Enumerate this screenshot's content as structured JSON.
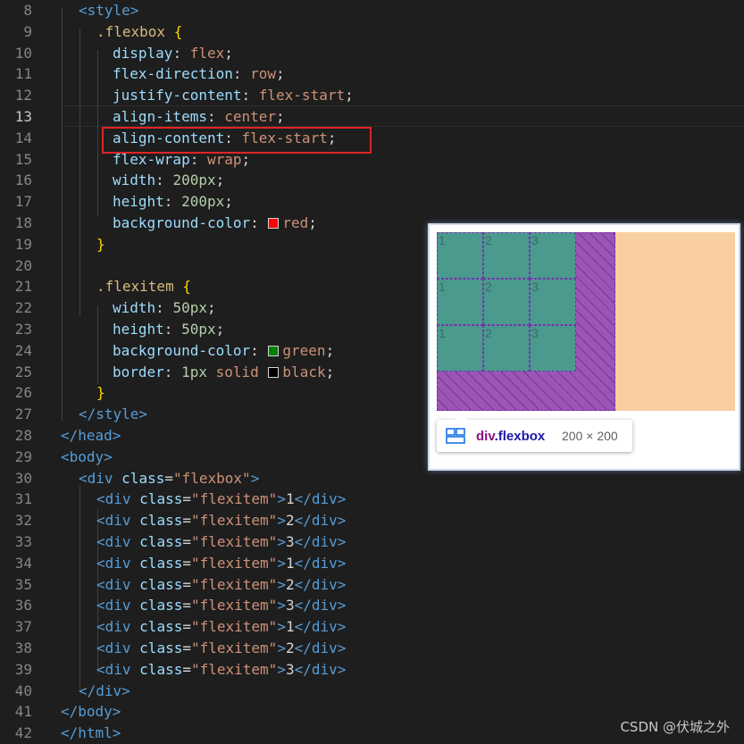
{
  "editor": {
    "lines": [
      {
        "n": "8",
        "indent": 88,
        "segs": [
          [
            "tag",
            "<style>"
          ]
        ]
      },
      {
        "n": "9",
        "indent": 108,
        "segs": [
          [
            "sel",
            ".flexbox "
          ],
          [
            "brace",
            "{"
          ]
        ]
      },
      {
        "n": "10",
        "indent": 126,
        "segs": [
          [
            "prop",
            "display"
          ],
          [
            "txt",
            ": "
          ],
          [
            "val",
            "flex"
          ],
          [
            "txt",
            ";"
          ]
        ]
      },
      {
        "n": "11",
        "indent": 126,
        "segs": [
          [
            "prop",
            "flex-direction"
          ],
          [
            "txt",
            ": "
          ],
          [
            "val",
            "row"
          ],
          [
            "txt",
            ";"
          ]
        ]
      },
      {
        "n": "12",
        "indent": 126,
        "segs": [
          [
            "prop",
            "justify-content"
          ],
          [
            "txt",
            ": "
          ],
          [
            "val",
            "flex-start"
          ],
          [
            "txt",
            ";"
          ]
        ]
      },
      {
        "n": "13",
        "indent": 126,
        "segs": [
          [
            "prop",
            "align-items"
          ],
          [
            "txt",
            ": "
          ],
          [
            "val",
            "center"
          ],
          [
            "txt",
            ";"
          ]
        ],
        "active": true
      },
      {
        "n": "14",
        "indent": 126,
        "segs": [
          [
            "prop",
            "align-content"
          ],
          [
            "txt",
            ": "
          ],
          [
            "val",
            "flex-start"
          ],
          [
            "txt",
            ";"
          ]
        ]
      },
      {
        "n": "15",
        "indent": 126,
        "segs": [
          [
            "prop",
            "flex-wrap"
          ],
          [
            "txt",
            ": "
          ],
          [
            "val",
            "wrap"
          ],
          [
            "txt",
            ";"
          ]
        ]
      },
      {
        "n": "16",
        "indent": 126,
        "segs": [
          [
            "prop",
            "width"
          ],
          [
            "txt",
            ": "
          ],
          [
            "num",
            "200px"
          ],
          [
            "txt",
            ";"
          ]
        ]
      },
      {
        "n": "17",
        "indent": 126,
        "segs": [
          [
            "prop",
            "height"
          ],
          [
            "txt",
            ": "
          ],
          [
            "num",
            "200px"
          ],
          [
            "txt",
            ";"
          ]
        ]
      },
      {
        "n": "18",
        "indent": 126,
        "segs": [
          [
            "prop",
            "background-color"
          ],
          [
            "txt",
            ": "
          ],
          [
            "swatch",
            "#ff0000"
          ],
          [
            "val",
            "red"
          ],
          [
            "txt",
            ";"
          ]
        ]
      },
      {
        "n": "19",
        "indent": 108,
        "segs": [
          [
            "brace",
            "}"
          ]
        ]
      },
      {
        "n": "20",
        "indent": 108,
        "segs": []
      },
      {
        "n": "21",
        "indent": 108,
        "segs": [
          [
            "sel",
            ".flexitem "
          ],
          [
            "brace",
            "{"
          ]
        ]
      },
      {
        "n": "22",
        "indent": 126,
        "segs": [
          [
            "prop",
            "width"
          ],
          [
            "txt",
            ": "
          ],
          [
            "num",
            "50px"
          ],
          [
            "txt",
            ";"
          ]
        ]
      },
      {
        "n": "23",
        "indent": 126,
        "segs": [
          [
            "prop",
            "height"
          ],
          [
            "txt",
            ": "
          ],
          [
            "num",
            "50px"
          ],
          [
            "txt",
            ";"
          ]
        ]
      },
      {
        "n": "24",
        "indent": 126,
        "segs": [
          [
            "prop",
            "background-color"
          ],
          [
            "txt",
            ": "
          ],
          [
            "swatch",
            "#008000"
          ],
          [
            "val",
            "green"
          ],
          [
            "txt",
            ";"
          ]
        ]
      },
      {
        "n": "25",
        "indent": 126,
        "segs": [
          [
            "prop",
            "border"
          ],
          [
            "txt",
            ": "
          ],
          [
            "num",
            "1px"
          ],
          [
            "txt",
            " "
          ],
          [
            "val",
            "solid"
          ],
          [
            "txt",
            " "
          ],
          [
            "swatch",
            "#000000"
          ],
          [
            "val",
            "black"
          ],
          [
            "txt",
            ";"
          ]
        ]
      },
      {
        "n": "26",
        "indent": 108,
        "segs": [
          [
            "brace",
            "}"
          ]
        ]
      },
      {
        "n": "27",
        "indent": 88,
        "segs": [
          [
            "tag",
            "</style>"
          ]
        ]
      },
      {
        "n": "28",
        "indent": 68,
        "segs": [
          [
            "tag",
            "</head>"
          ]
        ]
      },
      {
        "n": "29",
        "indent": 68,
        "segs": [
          [
            "tag",
            "<body>"
          ]
        ]
      },
      {
        "n": "30",
        "indent": 88,
        "segs": [
          [
            "tag",
            "<div "
          ],
          [
            "attr",
            "class"
          ],
          [
            "txt",
            "="
          ],
          [
            "str",
            "\"flexbox\""
          ],
          [
            "tag",
            ">"
          ]
        ]
      },
      {
        "n": "31",
        "indent": 108,
        "segs": [
          [
            "tag",
            "<div "
          ],
          [
            "attr",
            "class"
          ],
          [
            "txt",
            "="
          ],
          [
            "str",
            "\"flexitem\""
          ],
          [
            "tag",
            ">"
          ],
          [
            "txt",
            "1"
          ],
          [
            "tag",
            "</div>"
          ]
        ]
      },
      {
        "n": "32",
        "indent": 108,
        "segs": [
          [
            "tag",
            "<div "
          ],
          [
            "attr",
            "class"
          ],
          [
            "txt",
            "="
          ],
          [
            "str",
            "\"flexitem\""
          ],
          [
            "tag",
            ">"
          ],
          [
            "txt",
            "2"
          ],
          [
            "tag",
            "</div>"
          ]
        ]
      },
      {
        "n": "33",
        "indent": 108,
        "segs": [
          [
            "tag",
            "<div "
          ],
          [
            "attr",
            "class"
          ],
          [
            "txt",
            "="
          ],
          [
            "str",
            "\"flexitem\""
          ],
          [
            "tag",
            ">"
          ],
          [
            "txt",
            "3"
          ],
          [
            "tag",
            "</div>"
          ]
        ]
      },
      {
        "n": "34",
        "indent": 108,
        "segs": [
          [
            "tag",
            "<div "
          ],
          [
            "attr",
            "class"
          ],
          [
            "txt",
            "="
          ],
          [
            "str",
            "\"flexitem\""
          ],
          [
            "tag",
            ">"
          ],
          [
            "txt",
            "1"
          ],
          [
            "tag",
            "</div>"
          ]
        ]
      },
      {
        "n": "35",
        "indent": 108,
        "segs": [
          [
            "tag",
            "<div "
          ],
          [
            "attr",
            "class"
          ],
          [
            "txt",
            "="
          ],
          [
            "str",
            "\"flexitem\""
          ],
          [
            "tag",
            ">"
          ],
          [
            "txt",
            "2"
          ],
          [
            "tag",
            "</div>"
          ]
        ]
      },
      {
        "n": "36",
        "indent": 108,
        "segs": [
          [
            "tag",
            "<div "
          ],
          [
            "attr",
            "class"
          ],
          [
            "txt",
            "="
          ],
          [
            "str",
            "\"flexitem\""
          ],
          [
            "tag",
            ">"
          ],
          [
            "txt",
            "3"
          ],
          [
            "tag",
            "</div>"
          ]
        ]
      },
      {
        "n": "37",
        "indent": 108,
        "segs": [
          [
            "tag",
            "<div "
          ],
          [
            "attr",
            "class"
          ],
          [
            "txt",
            "="
          ],
          [
            "str",
            "\"flexitem\""
          ],
          [
            "tag",
            ">"
          ],
          [
            "txt",
            "1"
          ],
          [
            "tag",
            "</div>"
          ]
        ]
      },
      {
        "n": "38",
        "indent": 108,
        "segs": [
          [
            "tag",
            "<div "
          ],
          [
            "attr",
            "class"
          ],
          [
            "txt",
            "="
          ],
          [
            "str",
            "\"flexitem\""
          ],
          [
            "tag",
            ">"
          ],
          [
            "txt",
            "2"
          ],
          [
            "tag",
            "</div>"
          ]
        ]
      },
      {
        "n": "39",
        "indent": 108,
        "segs": [
          [
            "tag",
            "<div "
          ],
          [
            "attr",
            "class"
          ],
          [
            "txt",
            "="
          ],
          [
            "str",
            "\"flexitem\""
          ],
          [
            "tag",
            ">"
          ],
          [
            "txt",
            "3"
          ],
          [
            "tag",
            "</div>"
          ]
        ]
      },
      {
        "n": "40",
        "indent": 88,
        "segs": [
          [
            "tag",
            "</div>"
          ]
        ]
      },
      {
        "n": "41",
        "indent": 68,
        "segs": [
          [
            "tag",
            "</body>"
          ]
        ]
      },
      {
        "n": "42",
        "indent": 68,
        "segs": [
          [
            "tag",
            "</html>"
          ]
        ]
      }
    ]
  },
  "preview": {
    "items": [
      "1",
      "2",
      "3",
      "1",
      "2",
      "3",
      "1",
      "2",
      "3"
    ],
    "tooltip": {
      "icon": "flex-container-icon",
      "tag": "div",
      "class": ".flexbox",
      "size": "200 × 200"
    }
  },
  "watermark": "CSDN @伏城之外",
  "colors": {
    "flex_container": "#f9cfa2",
    "overlay": "#9b55b6",
    "item": "#4a9a8e",
    "highlight": "#e02424"
  }
}
